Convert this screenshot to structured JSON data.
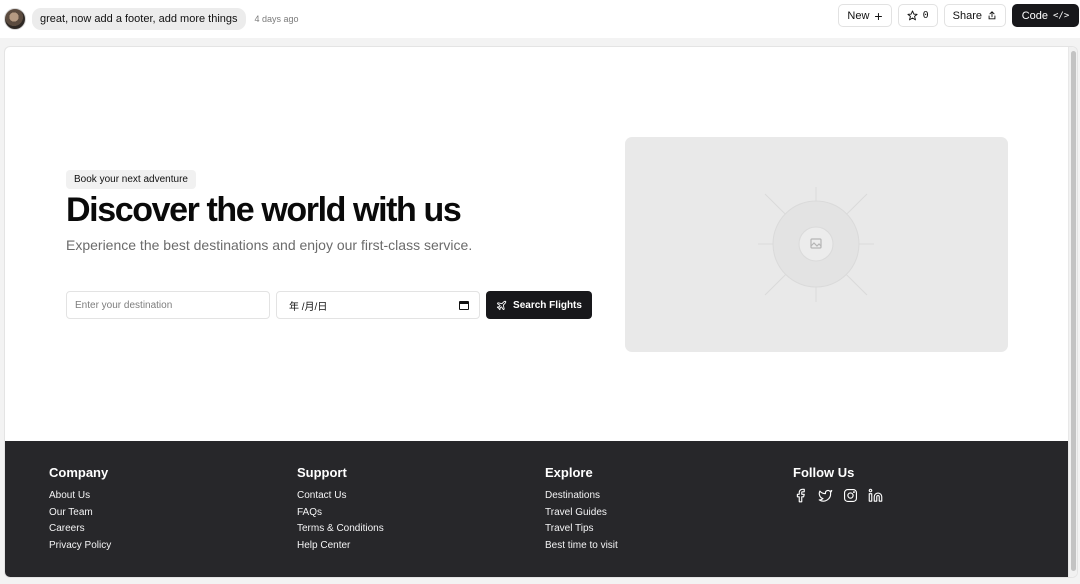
{
  "topbar": {
    "prompt": "great, now add a footer, add more things",
    "time": "4 days ago",
    "new_label": "New",
    "star_count": "0",
    "share_label": "Share",
    "code_label": "Code"
  },
  "hero": {
    "badge": "Book your next adventure",
    "title": "Discover the world with us",
    "subtitle": "Experience the best destinations and enjoy our first-class service.",
    "destination_placeholder": "Enter your destination",
    "date_value": "年 /月/日",
    "search_label": "Search Flights"
  },
  "footer": {
    "company": {
      "title": "Company",
      "links": [
        "About Us",
        "Our Team",
        "Careers",
        "Privacy Policy"
      ]
    },
    "support": {
      "title": "Support",
      "links": [
        "Contact Us",
        "FAQs",
        "Terms & Conditions",
        "Help Center"
      ]
    },
    "explore": {
      "title": "Explore",
      "links": [
        "Destinations",
        "Travel Guides",
        "Travel Tips",
        "Best time to visit"
      ]
    },
    "follow": {
      "title": "Follow Us",
      "icons": [
        "facebook-icon",
        "twitter-icon",
        "instagram-icon",
        "linkedin-icon"
      ]
    }
  },
  "colors": {
    "footer_bg": "#27272a",
    "button_dark": "#18181b",
    "placeholder_bg": "#e9e9e9"
  }
}
